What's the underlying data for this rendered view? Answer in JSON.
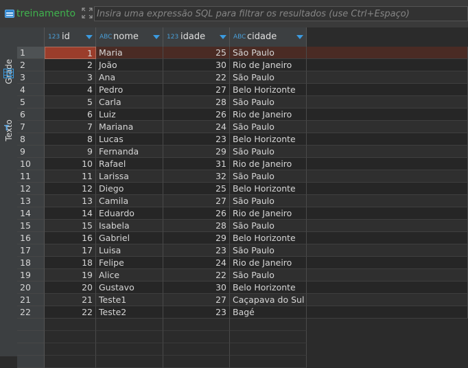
{
  "toolbar": {
    "table_name": "treinamento",
    "filter_placeholder": "Insira uma expressão SQL para filtrar os resultados (use Ctrl+Espaço)"
  },
  "side_tabs": {
    "grid_label": "Grade",
    "text_label": "Texto",
    "text_icon": "T"
  },
  "columns": [
    {
      "name": "id",
      "type_prefix": "123"
    },
    {
      "name": "nome",
      "type_prefix": "ABC"
    },
    {
      "name": "idade",
      "type_prefix": "123"
    },
    {
      "name": "cidade",
      "type_prefix": "ABC"
    }
  ],
  "rows": [
    {
      "rn": "1",
      "id": "1",
      "nome": "Maria",
      "idade": "25",
      "cidade": "São Paulo"
    },
    {
      "rn": "2",
      "id": "2",
      "nome": "João",
      "idade": "30",
      "cidade": "Rio de Janeiro"
    },
    {
      "rn": "3",
      "id": "3",
      "nome": "Ana",
      "idade": "22",
      "cidade": "São Paulo"
    },
    {
      "rn": "4",
      "id": "4",
      "nome": "Pedro",
      "idade": "27",
      "cidade": "Belo Horizonte"
    },
    {
      "rn": "5",
      "id": "5",
      "nome": "Carla",
      "idade": "28",
      "cidade": "São Paulo"
    },
    {
      "rn": "6",
      "id": "6",
      "nome": "Luiz",
      "idade": "26",
      "cidade": "Rio de Janeiro"
    },
    {
      "rn": "7",
      "id": "7",
      "nome": "Mariana",
      "idade": "24",
      "cidade": "São Paulo"
    },
    {
      "rn": "8",
      "id": "8",
      "nome": "Lucas",
      "idade": "23",
      "cidade": "Belo Horizonte"
    },
    {
      "rn": "9",
      "id": "9",
      "nome": "Fernanda",
      "idade": "29",
      "cidade": "São Paulo"
    },
    {
      "rn": "10",
      "id": "10",
      "nome": "Rafael",
      "idade": "31",
      "cidade": "Rio de Janeiro"
    },
    {
      "rn": "11",
      "id": "11",
      "nome": "Larissa",
      "idade": "32",
      "cidade": "São Paulo"
    },
    {
      "rn": "12",
      "id": "12",
      "nome": "Diego",
      "idade": "25",
      "cidade": "Belo Horizonte"
    },
    {
      "rn": "13",
      "id": "13",
      "nome": "Camila",
      "idade": "27",
      "cidade": "São Paulo"
    },
    {
      "rn": "14",
      "id": "14",
      "nome": "Eduardo",
      "idade": "26",
      "cidade": "Rio de Janeiro"
    },
    {
      "rn": "15",
      "id": "15",
      "nome": "Isabela",
      "idade": "28",
      "cidade": "São Paulo"
    },
    {
      "rn": "16",
      "id": "16",
      "nome": "Gabriel",
      "idade": "29",
      "cidade": "Belo Horizonte"
    },
    {
      "rn": "17",
      "id": "17",
      "nome": "Luisa",
      "idade": "23",
      "cidade": "São Paulo"
    },
    {
      "rn": "18",
      "id": "18",
      "nome": "Felipe",
      "idade": "24",
      "cidade": "Rio de Janeiro"
    },
    {
      "rn": "19",
      "id": "19",
      "nome": "Alice",
      "idade": "22",
      "cidade": "São Paulo"
    },
    {
      "rn": "20",
      "id": "20",
      "nome": "Gustavo",
      "idade": "30",
      "cidade": "Belo Horizonte"
    },
    {
      "rn": "21",
      "id": "21",
      "nome": "Teste1",
      "idade": "27",
      "cidade": "Caçapava do Sul"
    },
    {
      "rn": "22",
      "id": "22",
      "nome": "Teste2",
      "idade": "23",
      "cidade": "Bagé"
    }
  ],
  "selected_row": 1,
  "colors": {
    "table_name": "#3fb24d",
    "accent": "#3b9be0",
    "selected_cell": "#9a3d2b"
  }
}
